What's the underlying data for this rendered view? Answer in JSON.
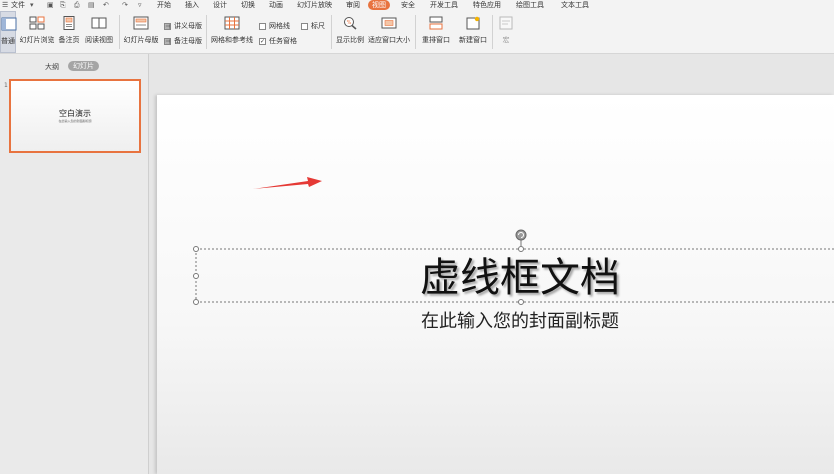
{
  "menubar": {
    "file_label": "文件",
    "tabs": [
      "开始",
      "插入",
      "设计",
      "切换",
      "动画",
      "幻灯片放映",
      "审阅",
      "视图",
      "安全",
      "开发工具",
      "特色应用",
      "绘图工具",
      "文本工具"
    ],
    "active_tab": "视图"
  },
  "ribbon": {
    "buttons": {
      "normal": "普通",
      "slide_browse": "幻灯片浏览",
      "notes_page": "备注页",
      "reading_view": "阅读视图",
      "slide_master": "幻灯片母版",
      "grid_guides": "网格和参考线",
      "zoom": "显示比例",
      "fit_window": "适应窗口大小",
      "arrange_window": "重排窗口",
      "new_window": "新建窗口",
      "more": "宏"
    },
    "checks": {
      "handout_master": "讲义母版",
      "notes_master": "备注母版",
      "gridlines": "网格线",
      "ruler": "标尺",
      "task_pane": "任务窗格"
    },
    "task_pane_checked": true
  },
  "leftpane": {
    "tab_outline": "大纲",
    "tab_slides": "幻灯片",
    "slide_number": "1",
    "thumb_title": "空白演示",
    "thumb_subtitle": "在此输入您的封面副标题"
  },
  "slide": {
    "title": "虚线框文档",
    "subtitle": "在此输入您的封面副标题"
  },
  "colors": {
    "accent": "#e8733f",
    "arrow": "#e53935"
  }
}
